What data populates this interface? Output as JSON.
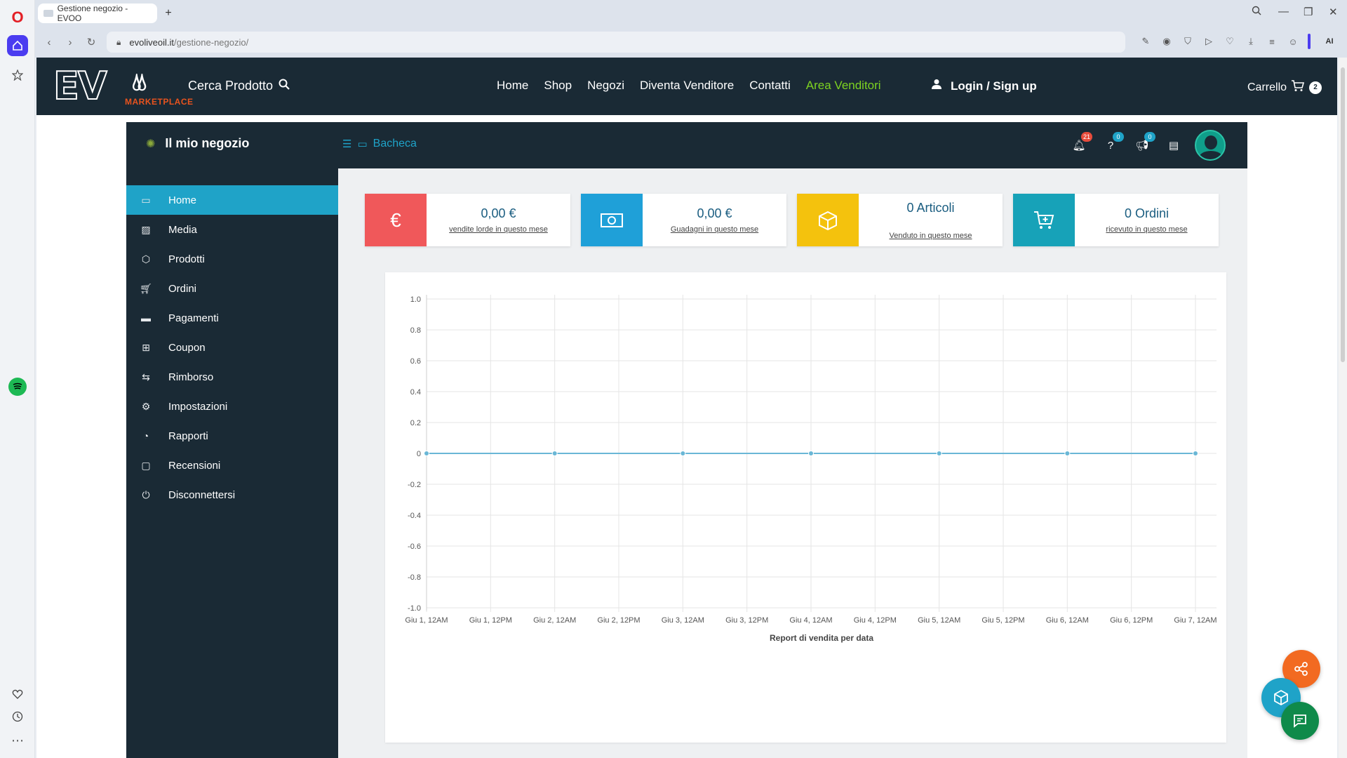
{
  "browser": {
    "tab_title": "Gestione negozio - EVOO",
    "new_tab": "+",
    "url_domain": "evoliveoil.it",
    "url_path": "/gestione-negozio/",
    "ai_label": "AI"
  },
  "site": {
    "logo_text": "EV",
    "logo_sub": "MARKETPLACE",
    "search_label": "Cerca Prodotto",
    "nav": [
      "Home",
      "Shop",
      "Negozi",
      "Diventa Venditore",
      "Contatti",
      "Area Venditori"
    ],
    "login_label": "Login / Sign up",
    "cart_label": "Carrello",
    "cart_count": "2"
  },
  "dashboard": {
    "store_title": "Il mio negozio",
    "breadcrumb": "Bacheca",
    "notifications": {
      "bell": "21",
      "help": "0",
      "megaphone": "0"
    },
    "sidebar": [
      "Home",
      "Media",
      "Prodotti",
      "Ordini",
      "Pagamenti",
      "Coupon",
      "Rimborso",
      "Impostazioni",
      "Rapporti",
      "Recensioni",
      "Disconnettersi"
    ],
    "cards": [
      {
        "value": "0,00 €",
        "label": "vendite lorde in questo mese",
        "icon": "€",
        "color": "#f0585a"
      },
      {
        "value": "0,00 €",
        "label": "Guadagni in questo mese",
        "icon": "banknote",
        "color": "#1fa0d8"
      },
      {
        "value": "0 Articoli",
        "label": "Venduto in questo mese",
        "icon": "box",
        "color": "#f4c20d"
      },
      {
        "value": "0 Ordini",
        "label": "ricevuto in questo mese",
        "icon": "cart",
        "color": "#17a2b8"
      }
    ]
  },
  "chart_data": {
    "type": "line",
    "x": [
      "Giu 1, 12AM",
      "Giu 1, 12PM",
      "Giu 2, 12AM",
      "Giu 2, 12PM",
      "Giu 3, 12AM",
      "Giu 3, 12PM",
      "Giu 4, 12AM",
      "Giu 4, 12PM",
      "Giu 5, 12AM",
      "Giu 5, 12PM",
      "Giu 6, 12AM",
      "Giu 6, 12PM",
      "Giu 7, 12AM"
    ],
    "points_x": [
      "Giu 1, 12AM",
      "Giu 2, 12AM",
      "Giu 3, 12AM",
      "Giu 4, 12AM",
      "Giu 5, 12AM",
      "Giu 6, 12AM",
      "Giu 7, 12AM"
    ],
    "values": [
      0,
      0,
      0,
      0,
      0,
      0,
      0
    ],
    "yticks": [
      "1.0",
      "0.8",
      "0.6",
      "0.4",
      "0.2",
      "0",
      "-0.2",
      "-0.4",
      "-0.6",
      "-0.8",
      "-1.0"
    ],
    "ylim": [
      -1.0,
      1.0
    ],
    "xlabel": "Report di vendita per data",
    "line_color": "#6ab7d6",
    "grid": true
  }
}
